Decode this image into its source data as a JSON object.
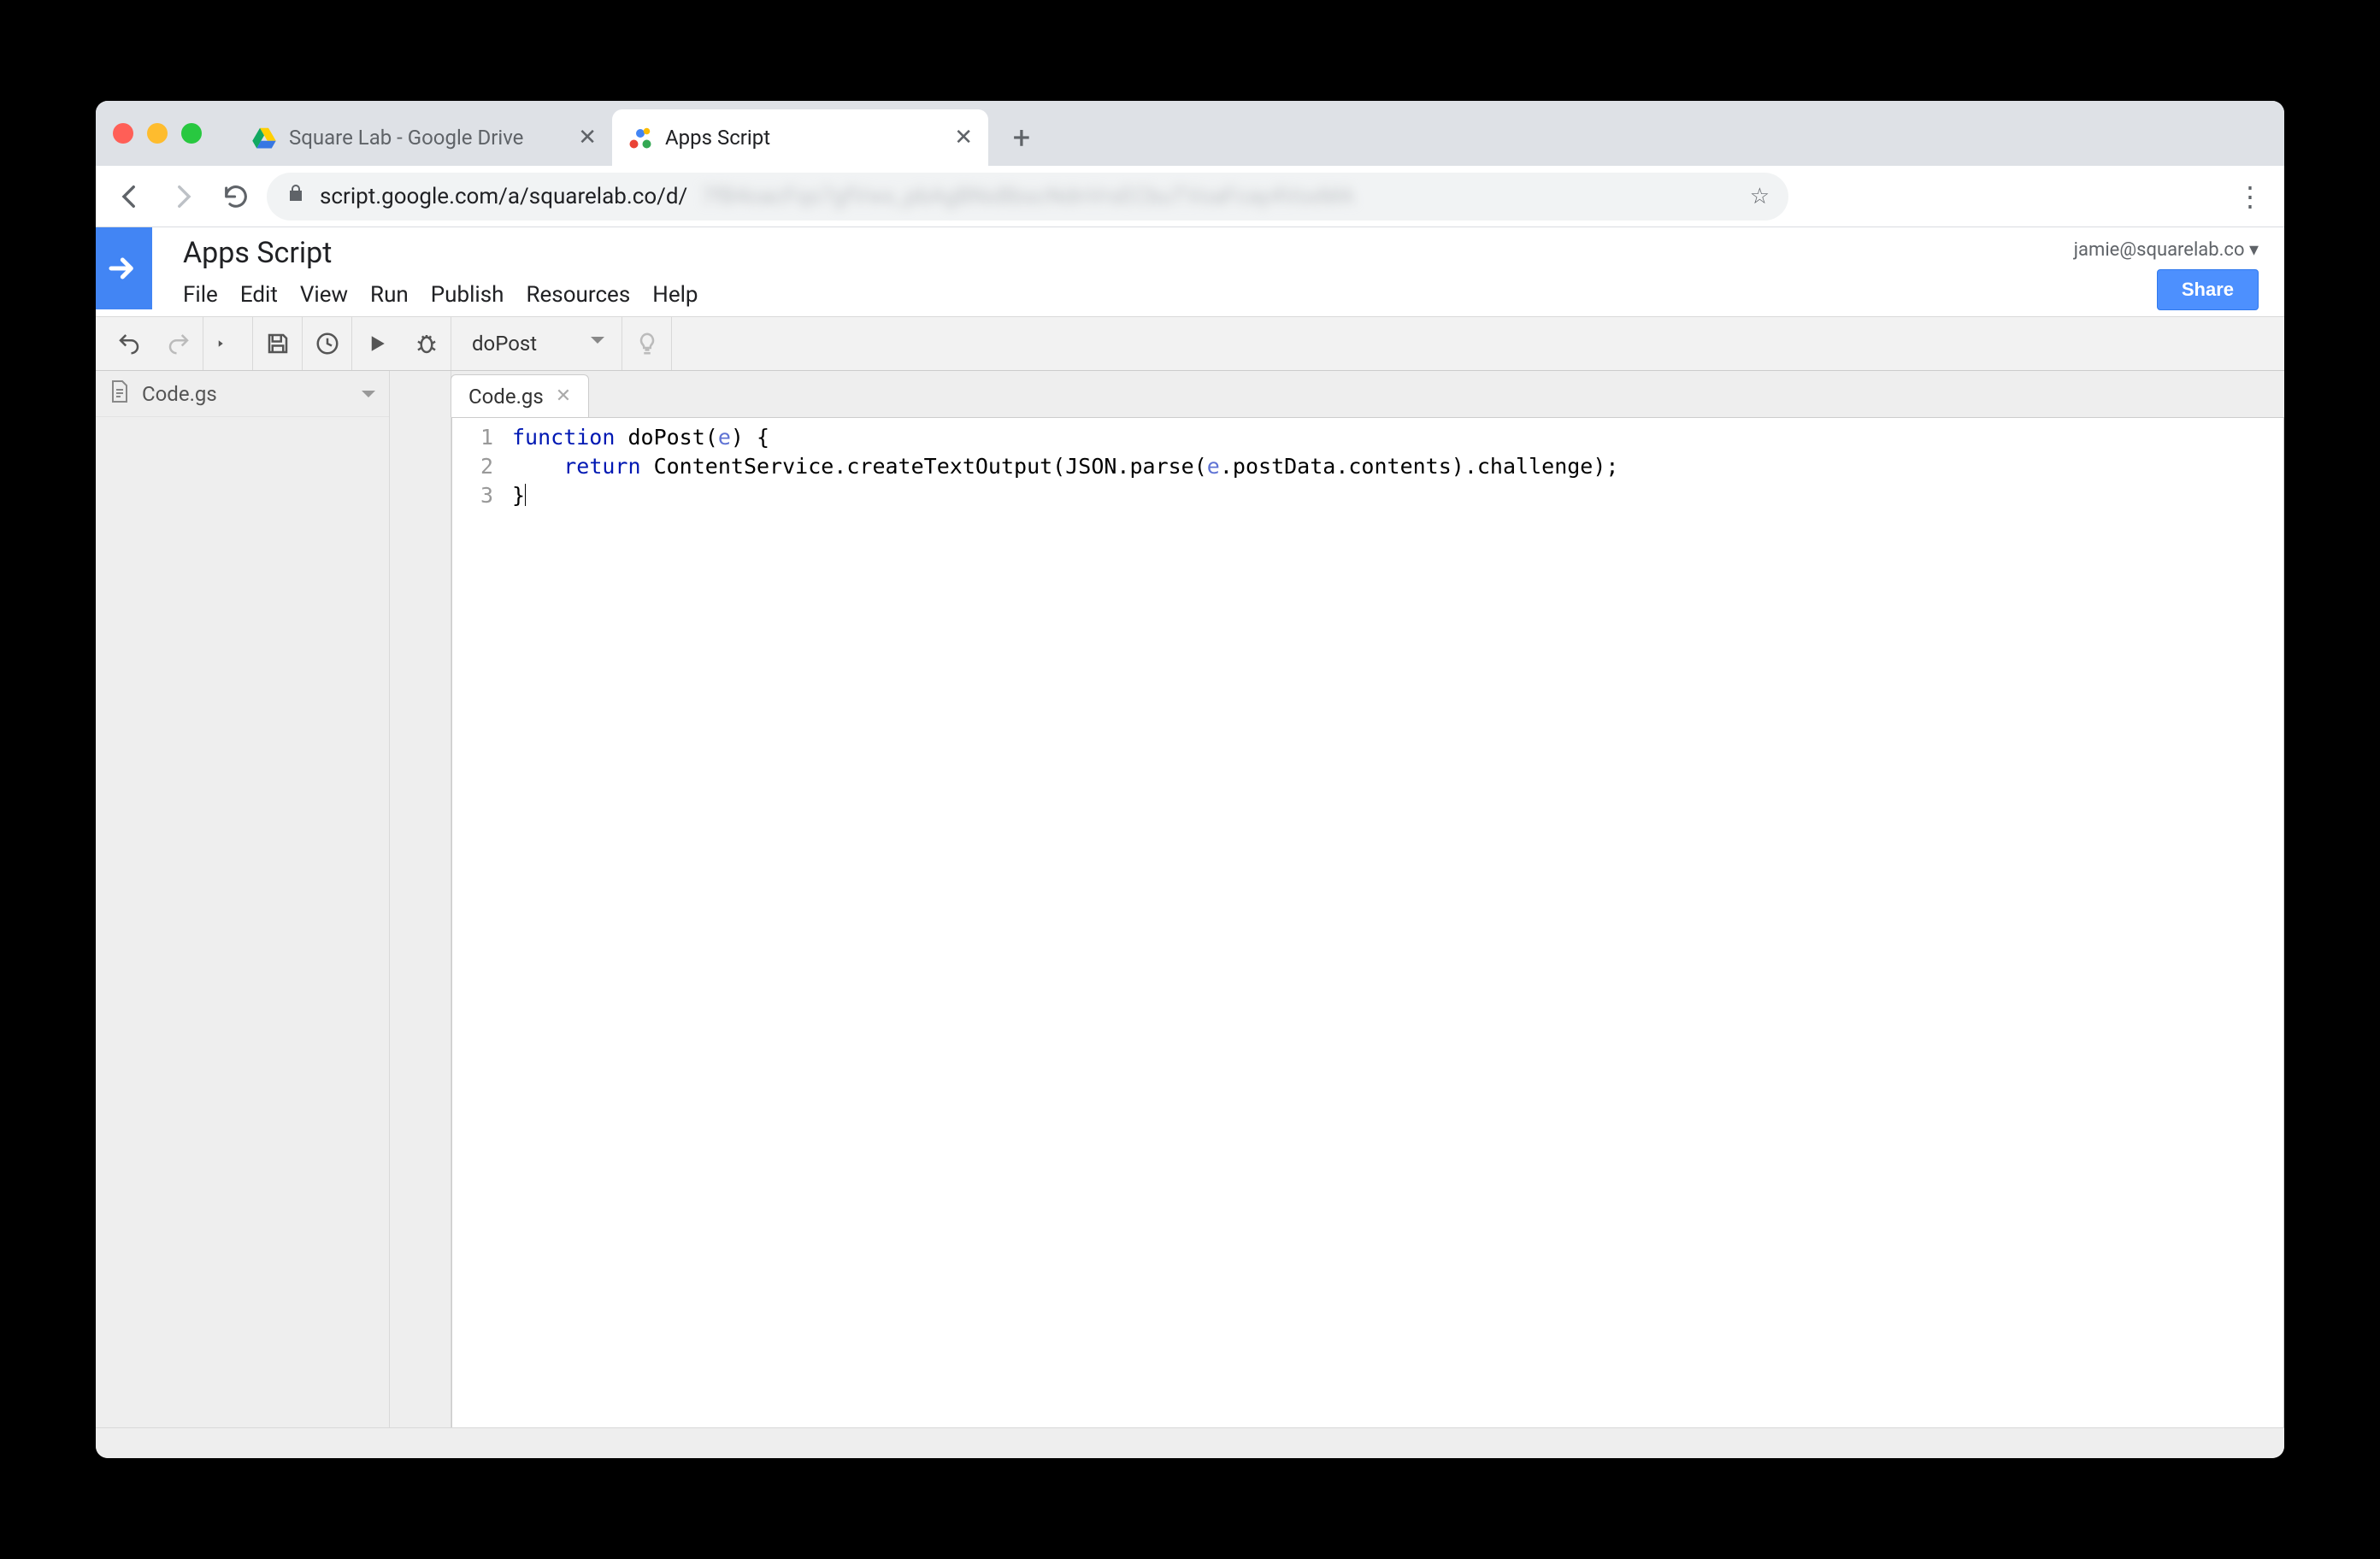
{
  "browser": {
    "tabs": [
      {
        "title": "Square Lab - Google Drive"
      },
      {
        "title": "Apps Script"
      }
    ],
    "url_visible_prefix": "script.google.com/a/squarelab.co/d/",
    "url_blurred_suffix": "7fB4oacFqs7gfVwx_pbAgBNxBbscNdnVrsECbuTVoaFcay4VoxMA"
  },
  "app": {
    "title": "Apps Script",
    "menus": [
      "File",
      "Edit",
      "View",
      "Run",
      "Publish",
      "Resources",
      "Help"
    ],
    "account": "jamie@squarelab.co",
    "share_label": "Share"
  },
  "toolbar": {
    "selected_function": "doPost"
  },
  "sidebar": {
    "files": [
      {
        "name": "Code.gs"
      }
    ]
  },
  "editor": {
    "tab_name": "Code.gs",
    "code_lines": [
      {
        "n": 1,
        "tokens": [
          [
            "kw",
            "function"
          ],
          [
            "",
            ""
          ],
          [
            "",
            "doPost("
          ],
          [
            "arg",
            "e"
          ],
          [
            "",
            ") {"
          ]
        ]
      },
      {
        "n": 2,
        "tokens": [
          [
            "",
            "    "
          ],
          [
            "kw",
            "return"
          ],
          [
            "",
            ""
          ],
          [
            "",
            "ContentService.createTextOutput(JSON.parse("
          ],
          [
            "arg",
            "e"
          ],
          [
            "",
            ".postData.contents).challenge);"
          ]
        ]
      },
      {
        "n": 3,
        "tokens": [
          [
            "",
            "}"
          ]
        ]
      }
    ]
  }
}
